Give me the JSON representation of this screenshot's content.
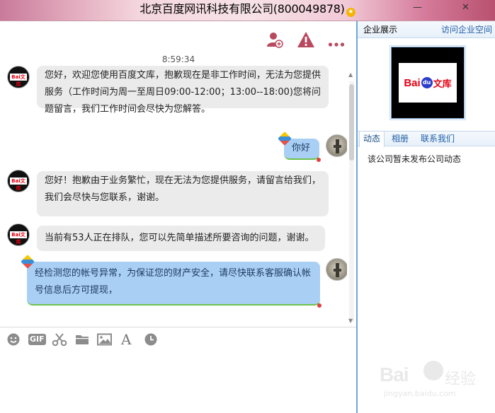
{
  "window": {
    "title": "北京百度网讯科技有限公司(800049878)",
    "badge": "★"
  },
  "chat": {
    "toolbar": {
      "icons": [
        "add-contact-icon",
        "warning-icon",
        "more-icon"
      ]
    },
    "timestamp": "8:59:34",
    "messages": [
      {
        "from": "agent",
        "text": "您好，欢迎您使用百度文库，抱歉现在是非工作时间，无法为您提供服务（工作时间为周一至周日09:00-12:00；13:00--18:00)您将问题留言，我们工作时间会尽快为您解答。"
      },
      {
        "from": "user",
        "text": "你好"
      },
      {
        "from": "agent",
        "text": "您好！抱歉由于业务繁忙，现在无法为您提供服务，请留言给我们，我们会尽快与您联系，谢谢。"
      },
      {
        "from": "agent",
        "text": "当前有53人正在排队，您可以先简单描述所要咨询的问题，谢谢。"
      },
      {
        "from": "user",
        "text": "经检测您的帐号异常，为保证您的财产安全，请尽快联系客服确认帐号信息后方可提现，"
      }
    ],
    "input_tools": [
      "emoji-icon",
      "gif-button",
      "screenshot-scissors-icon",
      "folder-icon",
      "image-icon",
      "font-icon",
      "history-clock-icon"
    ],
    "gif_label": "GIF",
    "font_label": "A"
  },
  "sidebar": {
    "header_title": "企业展示",
    "header_link": "访问企业空间",
    "logo": {
      "bai": "Bai",
      "du": "du",
      "wenku": "文库"
    },
    "tabs": [
      "动态",
      "相册",
      "联系我们"
    ],
    "empty_text": "该公司暂未发布公司动态"
  },
  "watermark": {
    "brand": "Bai",
    "jingyan": "经验",
    "url": "jingyan.baidu.com"
  },
  "colors": {
    "accent": "#6fa6d6",
    "sent_bubble": "#aacff5",
    "recv_bubble": "#ebebeb",
    "warning": "#b84a5f"
  }
}
